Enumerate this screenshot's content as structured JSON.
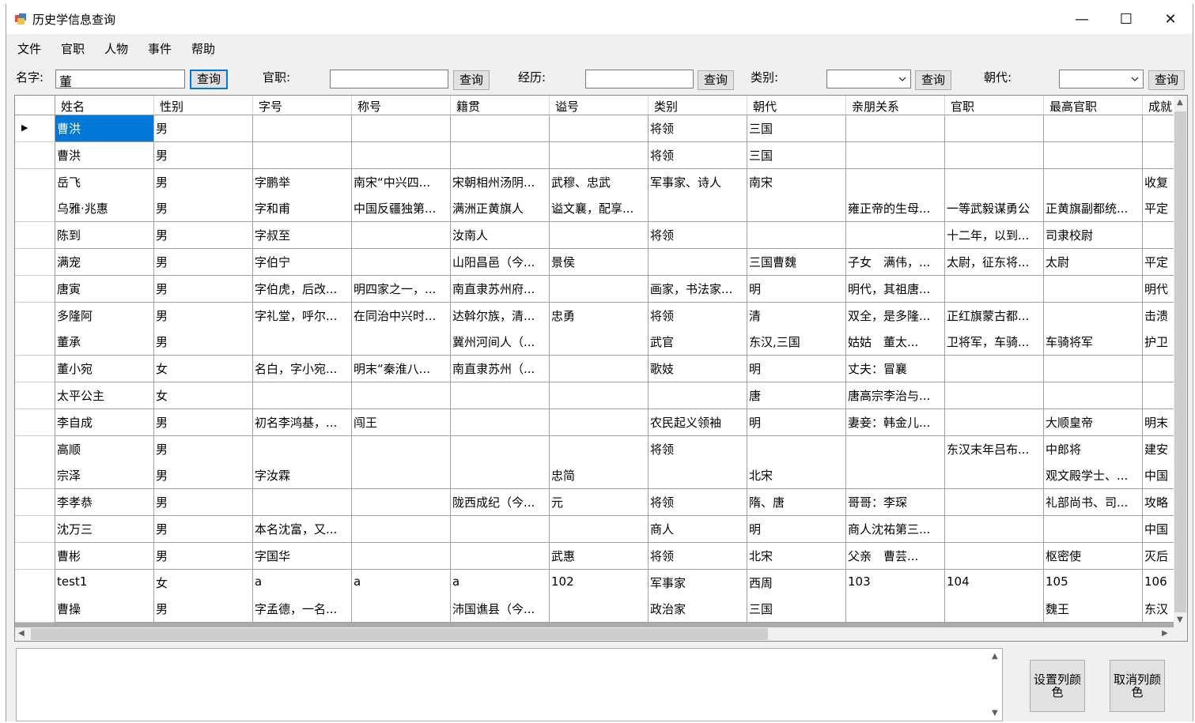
{
  "window": {
    "title": "历史学信息查询",
    "controls": {
      "minimize": "—",
      "maximize": "☐",
      "close": "✕"
    }
  },
  "menu": [
    "文件",
    "官职",
    "人物",
    "事件",
    "帮助"
  ],
  "search": {
    "name_label": "名字:",
    "name_value": "董",
    "query_label": "查询",
    "office_label": "官职:",
    "office_value": "",
    "experience_label": "经历:",
    "experience_value": "",
    "category_label": "类别:",
    "category_value": "",
    "dynasty_label": "朝代:",
    "dynasty_value": ""
  },
  "table": {
    "columns": [
      "姓名",
      "性别",
      "字号",
      "称号",
      "籍贯",
      "谥号",
      "类别",
      "朝代",
      "亲朋关系",
      "官职",
      "最高官职",
      "成就"
    ],
    "rows": [
      [
        "曹洪",
        "男",
        "",
        "",
        "",
        "",
        "将领",
        "三国",
        "",
        "",
        "",
        ""
      ],
      [
        "曹洪",
        "男",
        "",
        "",
        "",
        "",
        "将领",
        "三国",
        "",
        "",
        "",
        ""
      ],
      [
        "岳飞",
        "男",
        "字鹏举",
        "南宋“中兴四...",
        "宋朝相州汤阴...",
        "武穆、忠武",
        "军事家、诗人",
        "南宋",
        "",
        "",
        "",
        "收复"
      ],
      [
        "乌雅·兆惠",
        "男",
        "字和甫",
        "中国反疆独第...",
        "满洲正黄旗人",
        "谥文襄，配享...",
        "",
        "",
        "雍正帝的生母...",
        "一等武毅谋勇公",
        "正黄旗副都统...",
        "平定"
      ],
      [
        "陈到",
        "男",
        "字叔至",
        "",
        "汝南人",
        "",
        "将领",
        "",
        "",
        "十二年，以到...",
        "司隶校尉",
        ""
      ],
      [
        "满宠",
        "男",
        "字伯宁",
        "",
        "山阳昌邑（今...",
        "景侯",
        "",
        "三国曹魏",
        "子女　满伟，...",
        "太尉，征东将...",
        "太尉",
        "平定"
      ],
      [
        "唐寅",
        "男",
        "字伯虎，后改...",
        "明四家之一，...",
        "南直隶苏州府...",
        "",
        "画家，书法家...",
        "明",
        "明代，其祖唐...",
        "",
        "",
        "明代"
      ],
      [
        "多隆阿",
        "男",
        "字礼堂，呼尔...",
        "在同治中兴时...",
        "达斡尔族，清...",
        "忠勇",
        "将领",
        "清",
        "双全，是多隆...",
        "正红旗蒙古都...",
        "",
        "击溃"
      ],
      [
        "董承",
        "男",
        "",
        "",
        "冀州河间人（...",
        "",
        "武官",
        "东汉,三国",
        "姑姑　董太...",
        "卫将军，车骑...",
        "车骑将军",
        "护卫"
      ],
      [
        "董小宛",
        "女",
        "名白，字小宛...",
        "明末“秦淮八...",
        "南直隶苏州（...",
        "",
        "歌妓",
        "明",
        "丈夫：冒襄",
        "",
        "",
        ""
      ],
      [
        "太平公主",
        "女",
        "",
        "",
        "",
        "",
        "",
        "唐",
        "唐高宗李治与...",
        "",
        "",
        ""
      ],
      [
        "李自成",
        "男",
        "初名李鸿基，...",
        "闯王",
        "",
        "",
        "农民起义领袖",
        "明",
        "妻妾：韩金儿...",
        "",
        "大顺皇帝",
        "明末"
      ],
      [
        "高顺",
        "男",
        "",
        "",
        "",
        "",
        "将领",
        "",
        "",
        "东汉末年吕布...",
        "中郎将",
        "建安"
      ],
      [
        "宗泽",
        "男",
        "字汝霖",
        "",
        "",
        "忠简",
        "",
        "北宋",
        "",
        "",
        "观文殿学士、...",
        "中国"
      ],
      [
        "李孝恭",
        "男",
        "",
        "",
        "陇西成纪（今...",
        "元",
        "将领",
        "隋、唐",
        "哥哥：李琛",
        "",
        "礼部尚书、司...",
        "攻略"
      ],
      [
        "沈万三",
        "男",
        "本名沈富，又...",
        "",
        "",
        "",
        "商人",
        "明",
        "商人沈祐第三...",
        "",
        "",
        "中国"
      ],
      [
        "曹彬",
        "男",
        "字国华",
        "",
        "",
        "武惠",
        "将领",
        "北宋",
        "父亲　曹芸...",
        "",
        "枢密使",
        "灭后"
      ],
      [
        "test1",
        "女",
        "a",
        "a",
        "a",
        "102",
        "军事家",
        "西周",
        "103",
        "104",
        "105",
        "106"
      ],
      [
        "曹操",
        "男",
        "字孟德，一名...",
        "",
        "沛国谯县（今...",
        "",
        "政治家",
        "三国",
        "",
        "",
        "魏王",
        "东汉"
      ]
    ]
  },
  "buttons": {
    "set_color": "设置列颜色",
    "cancel_color": "取消列颜色"
  },
  "colors": {
    "selection": "#0078d7",
    "focus_border": "#0078d7",
    "grid_background": "#ababab"
  }
}
